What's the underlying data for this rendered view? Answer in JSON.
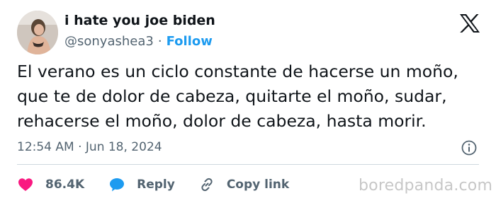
{
  "author": {
    "display_name": "i hate you joe biden",
    "handle": "@sonyashea3",
    "separator": "·",
    "follow_label": "Follow"
  },
  "tweet": {
    "lines": [
      "El verano es un ciclo constante de hacerse un moño,",
      "que te de dolor de cabeza, quitarte el moño, sudar,",
      "rehacerse el moño, dolor de cabeza, hasta morir."
    ],
    "timestamp": "12:54 AM · Jun 18, 2024"
  },
  "actions": {
    "like_count": "86.4K",
    "reply_label": "Reply",
    "copy_link_label": "Copy link"
  },
  "watermark": "boredpanda.com",
  "colors": {
    "accent": "#1d9bf0",
    "like": "#f91880",
    "text": "#0f1419",
    "muted": "#536471",
    "divider": "#cfd9de"
  },
  "icons": {
    "brand": "x-logo-icon",
    "info": "info-icon",
    "like": "heart-icon",
    "reply": "speech-bubble-icon",
    "copy_link": "link-icon"
  }
}
